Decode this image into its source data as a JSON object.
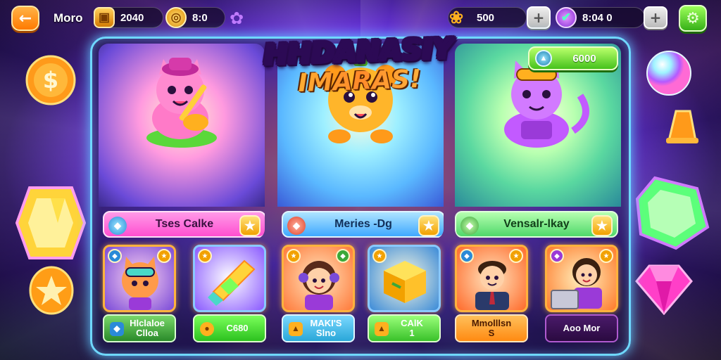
{
  "topbar": {
    "mode_label": "Moro",
    "currency1": "2040",
    "currency2": "8:0",
    "currency3": "500",
    "currency4": "8:04 0"
  },
  "title": {
    "line1": "HHDANASIY",
    "line2": "IMARAS!"
  },
  "bonus": {
    "value": "6000"
  },
  "characters": [
    {
      "name": "Tses Calke",
      "bar_color": "#ff5fd0"
    },
    {
      "name": "Meries -Dg",
      "bar_color": "#3fa8ff"
    },
    {
      "name": "Vensalr-lkay",
      "bar_color": "#4fd86a"
    }
  ],
  "items": [
    {
      "label_line1": "Hlclaloe",
      "label_line2": "Clloa",
      "label_color": "#3aa83a"
    },
    {
      "label_line1": "C680",
      "label_line2": "",
      "label_color": "#2cc11f"
    },
    {
      "label_line1": "MAKI'S",
      "label_line2": "Slno",
      "label_color": "#2aa7d8"
    },
    {
      "label_line1": "CAlK",
      "label_line2": "1",
      "label_color": "#39c12a"
    },
    {
      "label_line1": "Mmolllsn",
      "label_line2": "S",
      "label_color": "#ff8a12"
    },
    {
      "label_line1": "Aoo Mor",
      "label_line2": "",
      "label_color": "#b05ad0"
    }
  ],
  "icons": {
    "back": "arrow-left-icon",
    "currency1": "treasure-chest-icon",
    "currency2": "gold-coin-icon",
    "currency3": "gold-flower-icon",
    "currency4": "purple-gem-icon",
    "settings": "gear-icon"
  }
}
